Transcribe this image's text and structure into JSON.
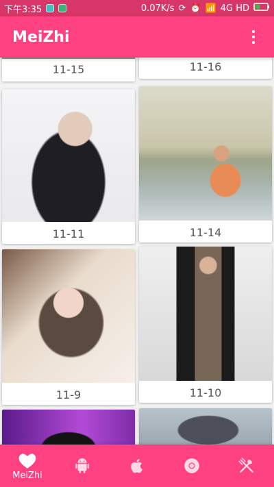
{
  "status": {
    "time": "下午3:35",
    "net": "0.07K/s",
    "network": "4G HD",
    "icons": [
      "notification-icon-teal",
      "notification-icon-green",
      "sync-icon",
      "alarm-icon",
      "signal-icon",
      "battery-icon"
    ]
  },
  "app": {
    "title": "MeiZhi"
  },
  "cards": [
    {
      "caption": "11-15"
    },
    {
      "caption": "11-16"
    },
    {
      "caption": "11-11"
    },
    {
      "caption": "11-14"
    },
    {
      "caption": "11-9"
    },
    {
      "caption": "11-10"
    }
  ],
  "nav": [
    {
      "label": "MeiZhi",
      "icon": "heart-icon"
    },
    {
      "label": "",
      "icon": "android-icon"
    },
    {
      "label": "",
      "icon": "apple-icon"
    },
    {
      "label": "",
      "icon": "chrome-icon"
    },
    {
      "label": "",
      "icon": "fork-knife-icon"
    }
  ],
  "colors": {
    "primary": "#ff4081",
    "statusbar": "#d83668"
  }
}
